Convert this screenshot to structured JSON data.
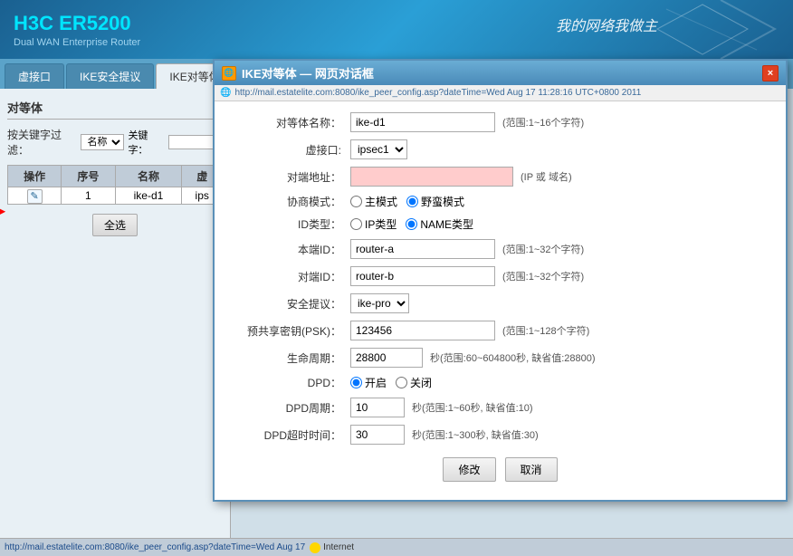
{
  "header": {
    "model": "H3C",
    "model_highlight": "ER5200",
    "subtitle": "Dual WAN Enterprise Router",
    "slogan": "我的网络我做主"
  },
  "nav": {
    "tabs": [
      {
        "label": "虚接口",
        "active": false
      },
      {
        "label": "IKE安全提议",
        "active": false
      },
      {
        "label": "IKE对等体",
        "active": true
      }
    ]
  },
  "left_panel": {
    "title": "对等体",
    "filter_label": "按关键字过滤：",
    "filter_option": "名称",
    "filter_input_placeholder": "关键字：",
    "table_headers": [
      "操作",
      "序号",
      "名称",
      "虚"
    ],
    "rows": [
      {
        "action": "✎",
        "index": "1",
        "name": "ike-d1",
        "iface": "ips"
      }
    ],
    "select_all_btn": "全选"
  },
  "dialog": {
    "title": "IKE对等体 — 网页对话框",
    "address": "http://mail.estatelite.com:8080/ike_peer_config.asp?dateTime=Wed Aug 17 11:28:16 UTC+0800 2011",
    "close_label": "×",
    "fields": {
      "peer_name_label": "对等体名称：",
      "peer_name_value": "ike-d1",
      "peer_name_hint": "(范围:1~16个字符)",
      "iface_label": "虚接口:",
      "iface_value": "ipsec1",
      "remote_addr_label": "对端地址：",
      "remote_addr_value": "",
      "remote_addr_hint": "(IP 或 域名)",
      "mode_label": "协商模式：",
      "mode_main": "主模式",
      "mode_aggressive": "野蛮模式",
      "mode_selected": "aggressive",
      "id_type_label": "ID类型：",
      "id_ip": "IP类型",
      "id_name": "NAME类型",
      "id_selected": "name",
      "local_id_label": "本端ID：",
      "local_id_value": "router-a",
      "local_id_hint": "(范围:1~32个字符)",
      "remote_id_label": "对端ID：",
      "remote_id_value": "router-b",
      "remote_id_hint": "(范围:1~32个字符)",
      "security_label": "安全提议：",
      "security_value": "ike-pro",
      "psk_label": "预共享密钥(PSK)：",
      "psk_value": "123456",
      "psk_hint": "(范围:1~128个字符)",
      "lifetime_label": "生命周期：",
      "lifetime_value": "28800",
      "lifetime_hint": "秒(范围:60~604800秒, 缺省值:28800)",
      "dpd_label": "DPD：",
      "dpd_on": "开启",
      "dpd_off": "关闭",
      "dpd_selected": "on",
      "dpd_period_label": "DPD周期：",
      "dpd_period_value": "10",
      "dpd_period_hint": "秒(范围:1~60秒, 缺省值:10)",
      "dpd_timeout_label": "DPD超时时间：",
      "dpd_timeout_value": "30",
      "dpd_timeout_hint": "秒(范围:1~300秒, 缺省值:30)"
    },
    "buttons": {
      "modify": "修改",
      "cancel": "取消"
    }
  },
  "status_bar": {
    "url": "http://mail.estatelite.com:8080/ike_peer_config.asp?dateTime=Wed Aug 17",
    "status": "Internet"
  }
}
